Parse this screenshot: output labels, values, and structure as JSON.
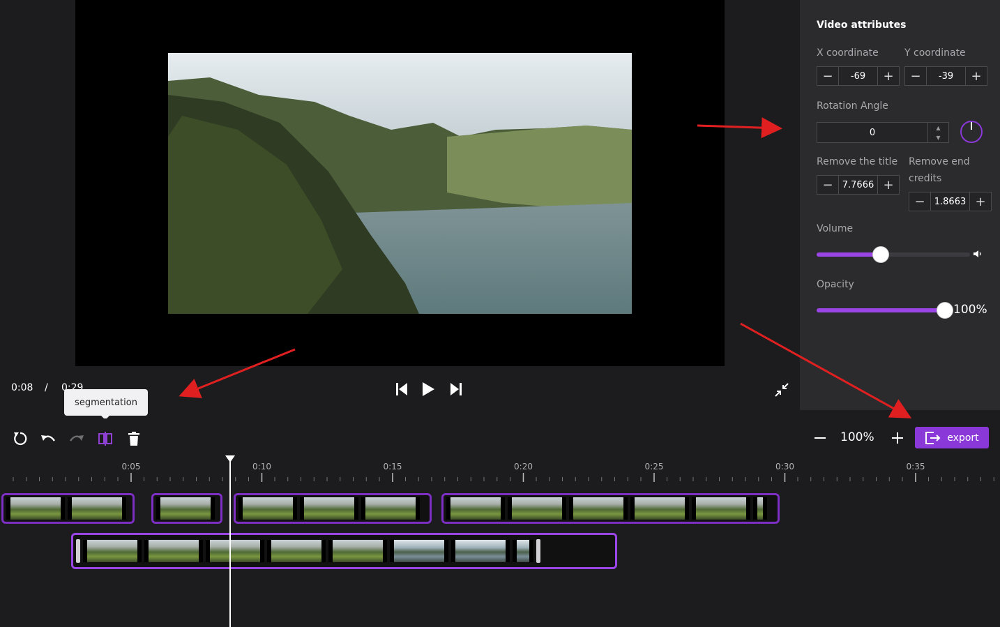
{
  "player": {
    "current_time": "0:08",
    "separator": "/",
    "total_time": "0:29",
    "tooltip": "segmentation"
  },
  "panel": {
    "title": "Video attributes",
    "x_label": "X coordinate",
    "x_value": "-69",
    "y_label": "Y coordinate",
    "y_value": "-39",
    "rotation_label": "Rotation Angle",
    "rotation_value": "0",
    "remove_title_label": "Remove the title",
    "remove_title_value": "7.7666",
    "remove_credits_label_1": "Remove end",
    "remove_credits_label_2": "credits",
    "remove_credits_value": "1.8663",
    "volume_label": "Volume",
    "volume_level": 0.42,
    "opacity_label": "Opacity",
    "opacity_value": "100%",
    "opacity_level": 1.0,
    "stepper_minus": "−",
    "stepper_plus": "+"
  },
  "toolbar": {
    "zoom_value": "100%",
    "export_label": "export"
  },
  "timeline": {
    "ticks": [
      "0:05",
      "0:10",
      "0:15",
      "0:20",
      "0:25",
      "0:30",
      "0:35"
    ]
  },
  "colors": {
    "accent": "#8a38d8",
    "panel_bg": "#2b2b2e",
    "app_bg": "#1c1c1e",
    "annotation_arrow": "#e02020"
  },
  "icons": {
    "reset": "rotate-ccw-icon",
    "undo": "undo-icon",
    "redo": "redo-icon",
    "split": "split-icon",
    "delete": "trash-icon",
    "prev": "skip-back-icon",
    "play": "play-icon",
    "next": "skip-forward-icon",
    "shrink": "minimize-icon",
    "volume": "speaker-icon",
    "export": "export-icon"
  }
}
